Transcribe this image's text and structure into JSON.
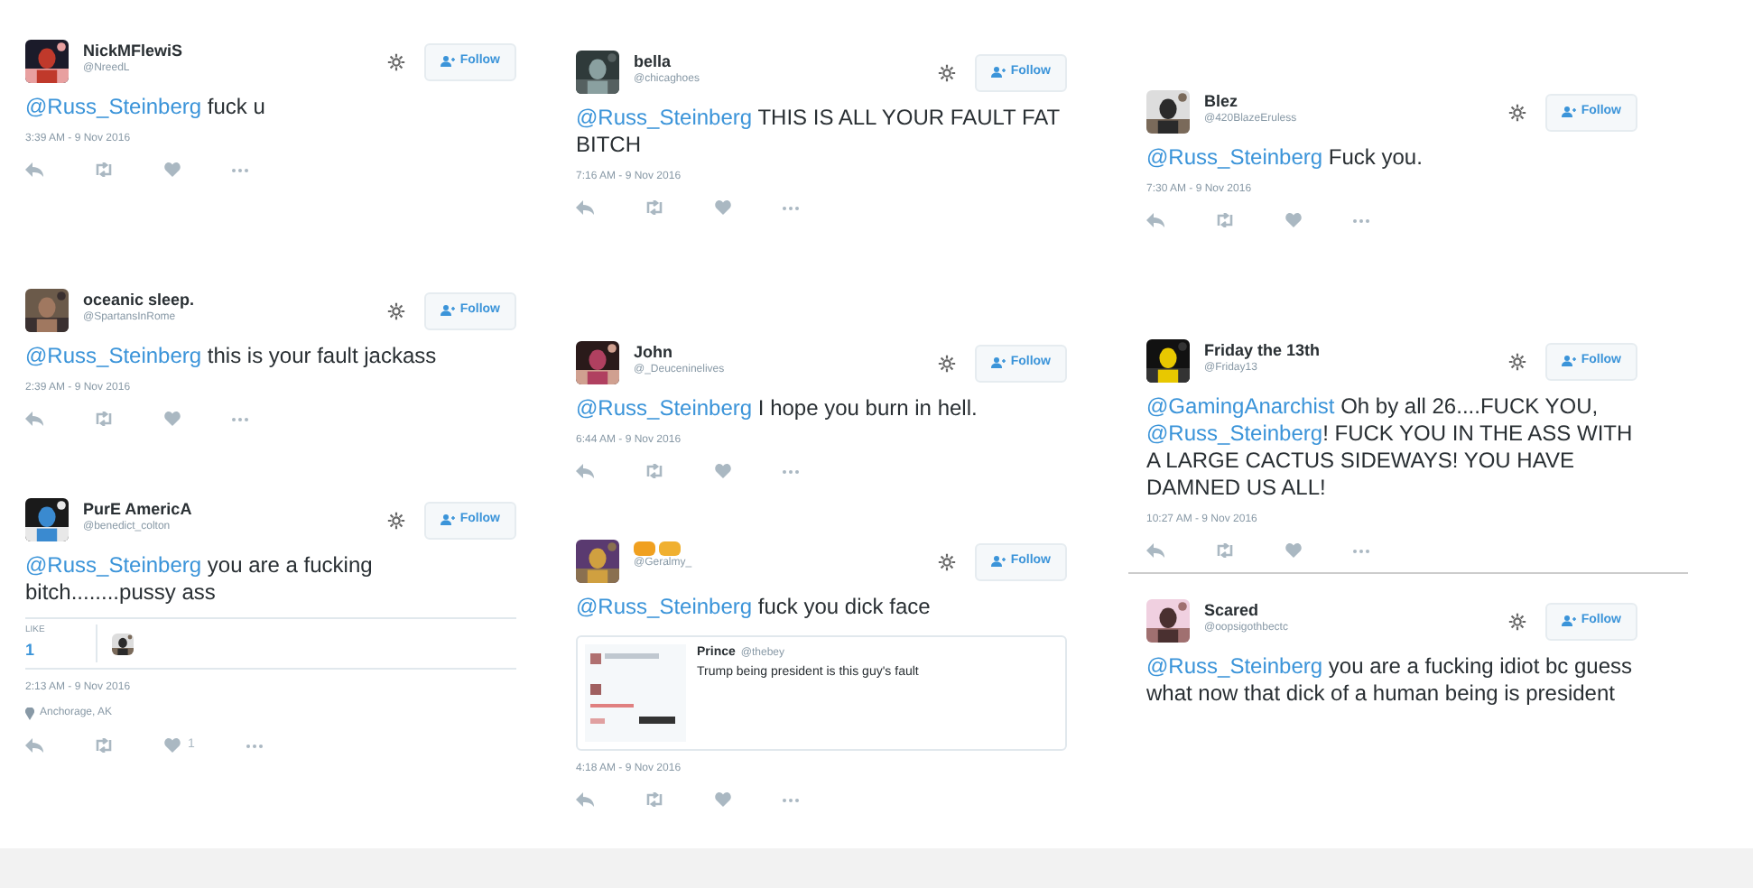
{
  "columns": [
    {
      "tweets": [
        {
          "name": "NickMFlewiS",
          "handle": "@NreedL",
          "follow": "Follow",
          "message": [
            {
              "kind": "mention",
              "text": "@Russ_Steinberg"
            },
            {
              "kind": "text",
              "text": " fuck u"
            }
          ],
          "time": "3:39 AM - 9 Nov 2016"
        },
        {
          "name": "oceanic sleep.",
          "handle": "@SpartansInRome",
          "follow": "Follow",
          "message": [
            {
              "kind": "mention",
              "text": "@Russ_Steinberg"
            },
            {
              "kind": "text",
              "text": " this is your fault jackass"
            }
          ],
          "time": "2:39 AM - 9 Nov 2016"
        },
        {
          "name": "PurE AmericA",
          "handle": "@benedict_colton",
          "follow": "Follow",
          "message": [
            {
              "kind": "mention",
              "text": "@Russ_Steinberg"
            },
            {
              "kind": "text",
              "text": " you are a fucking bitch........pussy ass"
            }
          ],
          "stats": {
            "label": "LIKE",
            "count": "1"
          },
          "time": "2:13 AM - 9 Nov 2016",
          "location": "Anchorage, AK",
          "like_count": "1"
        }
      ]
    },
    {
      "tweets": [
        {
          "name": "bella",
          "handle": "@chicaghoes",
          "follow": "Follow",
          "message": [
            {
              "kind": "mention",
              "text": "@Russ_Steinberg"
            },
            {
              "kind": "text",
              "text": " THIS IS ALL YOUR FAULT FAT BITCH"
            }
          ],
          "time": "7:16 AM - 9 Nov 2016"
        },
        {
          "name": "John",
          "handle": "@_Deuceninelives",
          "follow": "Follow",
          "message": [
            {
              "kind": "mention",
              "text": "@Russ_Steinberg"
            },
            {
              "kind": "text",
              "text": " I hope you burn in hell."
            }
          ],
          "time": "6:44 AM - 9 Nov 2016"
        },
        {
          "handle": "@Geralmy_",
          "follow": "Follow",
          "message": [
            {
              "kind": "mention",
              "text": "@Russ_Steinberg"
            },
            {
              "kind": "text",
              "text": " fuck you dick face"
            }
          ],
          "quote": {
            "name": "Prince",
            "handle": "@thebey",
            "text": "Trump being president is this guy's fault"
          },
          "time": "4:18 AM - 9 Nov 2016"
        }
      ]
    },
    {
      "tweets": [
        {
          "name": "Blez",
          "handle": "@420BlazeEruless",
          "follow": "Follow",
          "message": [
            {
              "kind": "mention",
              "text": "@Russ_Steinberg"
            },
            {
              "kind": "text",
              "text": " Fuck you."
            }
          ],
          "time": "7:30 AM - 9 Nov 2016"
        },
        {
          "name": "Friday the 13th",
          "handle": "@Friday13",
          "follow": "Follow",
          "message": [
            {
              "kind": "mention",
              "text": "@GamingAnarchist"
            },
            {
              "kind": "text",
              "text": " Oh by all 26....FUCK YOU, "
            },
            {
              "kind": "mention",
              "text": "@Russ_Steinberg"
            },
            {
              "kind": "text",
              "text": "! FUCK YOU IN THE ASS WITH A LARGE CACTUS SIDEWAYS! YOU HAVE DAMNED US ALL!"
            }
          ],
          "time": "10:27 AM - 9 Nov 2016"
        },
        {
          "name": "Scared",
          "handle": "@oopsigothbectc",
          "follow": "Follow",
          "message": [
            {
              "kind": "mention",
              "text": "@Russ_Steinberg"
            },
            {
              "kind": "text",
              "text": " you are a fucking idiot bc guess what now that dick of a human being is president"
            }
          ],
          "divider_before": true
        }
      ]
    }
  ]
}
